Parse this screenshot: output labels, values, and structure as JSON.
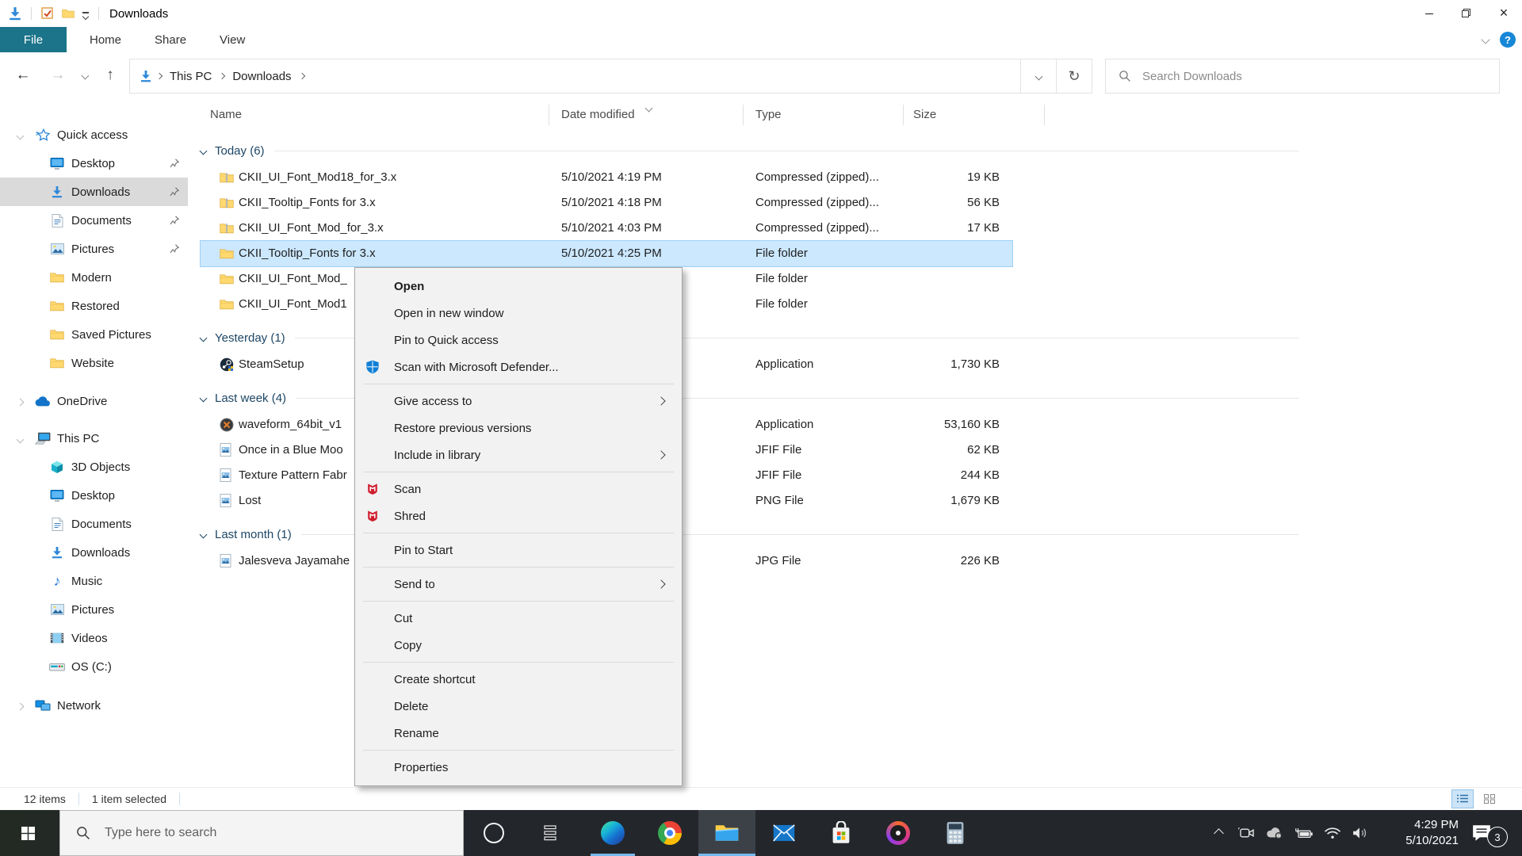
{
  "colors": {
    "file_tab_teal": "#1b7489",
    "selection_blue": "#cce8ff",
    "selection_border": "#9ed1f7",
    "group_header_blue": "#1d4665",
    "sidebar_selected_gray": "#dadada",
    "taskbar_dark": "#23262b",
    "accent_blue": "#0f7fd7",
    "taskbar_underline": "#76b9ed"
  },
  "titlebar": {
    "title": "Downloads",
    "qat_icons": [
      "downloads-arrow",
      "properties-check",
      "new-folder",
      "customize-caret"
    ],
    "controls": [
      "minimize",
      "restore",
      "close"
    ]
  },
  "ribbon": {
    "tabs": [
      {
        "label": "File",
        "active": true
      },
      {
        "label": "Home"
      },
      {
        "label": "Share"
      },
      {
        "label": "View"
      }
    ],
    "help_label": "?"
  },
  "address": {
    "crumb_root": "This PC",
    "crumb_folder": "Downloads",
    "search_placeholder": "Search Downloads"
  },
  "sidebar": {
    "items": [
      {
        "label": "Quick access",
        "icon": "quick-access-star",
        "level": 0,
        "expanded": true
      },
      {
        "label": "Desktop",
        "icon": "desktop",
        "level": 1,
        "pinned": true
      },
      {
        "label": "Downloads",
        "icon": "downloads-arrow",
        "level": 1,
        "pinned": true,
        "selected": true
      },
      {
        "label": "Documents",
        "icon": "document",
        "level": 1,
        "pinned": true
      },
      {
        "label": "Pictures",
        "icon": "pictures",
        "level": 1,
        "pinned": true
      },
      {
        "label": "Modern",
        "icon": "folder",
        "level": 1
      },
      {
        "label": "Restored",
        "icon": "folder",
        "level": 1
      },
      {
        "label": "Saved Pictures",
        "icon": "folder",
        "level": 1
      },
      {
        "label": "Website",
        "icon": "folder",
        "level": 1
      },
      {
        "label": "OneDrive",
        "icon": "onedrive-cloud",
        "level": 0
      },
      {
        "label": "This PC",
        "icon": "this-pc",
        "level": 0,
        "expanded": true
      },
      {
        "label": "3D Objects",
        "icon": "3d-cube",
        "level": 1
      },
      {
        "label": "Desktop",
        "icon": "desktop",
        "level": 1
      },
      {
        "label": "Documents",
        "icon": "document",
        "level": 1
      },
      {
        "label": "Downloads",
        "icon": "downloads-arrow",
        "level": 1
      },
      {
        "label": "Music",
        "icon": "music-note",
        "level": 1
      },
      {
        "label": "Pictures",
        "icon": "pictures",
        "level": 1
      },
      {
        "label": "Videos",
        "icon": "videos",
        "level": 1
      },
      {
        "label": "OS (C:)",
        "icon": "drive",
        "level": 1
      },
      {
        "label": "Network",
        "icon": "network",
        "level": 0
      }
    ]
  },
  "files": {
    "columns": [
      "Name",
      "Date modified",
      "Type",
      "Size"
    ],
    "sort_column": "Date modified",
    "groups": [
      {
        "label": "Today (6)",
        "rows": [
          {
            "name": "CKII_UI_Font_Mod18_for_3.x",
            "date": "5/10/2021 4:19 PM",
            "type": "Compressed (zipped)...",
            "size": "19 KB",
            "icon": "zip-folder"
          },
          {
            "name": "CKII_Tooltip_Fonts for 3.x",
            "date": "5/10/2021 4:18 PM",
            "type": "Compressed (zipped)...",
            "size": "56 KB",
            "icon": "zip-folder"
          },
          {
            "name": "CKII_UI_Font_Mod_for_3.x",
            "date": "5/10/2021 4:03 PM",
            "type": "Compressed (zipped)...",
            "size": "17 KB",
            "icon": "zip-folder"
          },
          {
            "name": "CKII_Tooltip_Fonts for 3.x",
            "date": "5/10/2021 4:25 PM",
            "type": "File folder",
            "size": "",
            "icon": "folder",
            "selected": true
          },
          {
            "name": "CKII_UI_Font_Mod_",
            "date": "",
            "type": "File folder",
            "size": "",
            "icon": "folder"
          },
          {
            "name": "CKII_UI_Font_Mod1",
            "date": "",
            "type": "File folder",
            "size": "",
            "icon": "folder"
          }
        ]
      },
      {
        "label": "Yesterday (1)",
        "rows": [
          {
            "name": "SteamSetup",
            "date": "",
            "type": "Application",
            "size": "1,730 KB",
            "icon": "steam"
          }
        ]
      },
      {
        "label": "Last week (4)",
        "rows": [
          {
            "name": "waveform_64bit_v1",
            "date": "",
            "type": "Application",
            "size": "53,160 KB",
            "icon": "waveform"
          },
          {
            "name": "Once in a Blue Moo",
            "date": "",
            "type": "JFIF File",
            "size": "62 KB",
            "icon": "image-file"
          },
          {
            "name": "Texture Pattern Fabr",
            "date": "",
            "type": "JFIF File",
            "size": "244 KB",
            "icon": "image-file"
          },
          {
            "name": "Lost",
            "date": "",
            "type": "PNG File",
            "size": "1,679 KB",
            "icon": "image-file"
          }
        ]
      },
      {
        "label": "Last month (1)",
        "rows": [
          {
            "name": "Jalesveva Jayamahe",
            "date": "",
            "type": "JPG File",
            "size": "226 KB",
            "icon": "image-file"
          }
        ]
      }
    ]
  },
  "context_menu": {
    "items": [
      {
        "label": "Open",
        "bold": true
      },
      {
        "label": "Open in new window"
      },
      {
        "label": "Pin to Quick access"
      },
      {
        "label": "Scan with Microsoft Defender...",
        "icon": "defender-shield"
      },
      {
        "label": "Give access to",
        "submenu": true
      },
      {
        "label": "Restore previous versions"
      },
      {
        "label": "Include in library",
        "submenu": true
      },
      {
        "label": "Scan",
        "icon": "mcafee-shield"
      },
      {
        "label": "Shred",
        "icon": "mcafee-shield"
      },
      {
        "label": "Pin to Start"
      },
      {
        "label": "Send to",
        "submenu": true
      },
      {
        "label": "Cut"
      },
      {
        "label": "Copy"
      },
      {
        "label": "Create shortcut"
      },
      {
        "label": "Delete"
      },
      {
        "label": "Rename"
      },
      {
        "label": "Properties"
      }
    ]
  },
  "statusbar": {
    "item_count": "12 items",
    "selection": "1 item selected"
  },
  "taskbar": {
    "search_placeholder": "Type here to search",
    "pinned_apps": [
      "cortana",
      "task-view",
      "edge",
      "chrome",
      "file-explorer",
      "mail",
      "store",
      "music",
      "calculator"
    ],
    "tray_icons": [
      "hidden-icons-chevron",
      "meet-now",
      "onedrive-paused",
      "battery-charging",
      "wifi",
      "volume"
    ],
    "clock": {
      "time": "4:29 PM",
      "date": "5/10/2021"
    },
    "notification_count": "3"
  }
}
